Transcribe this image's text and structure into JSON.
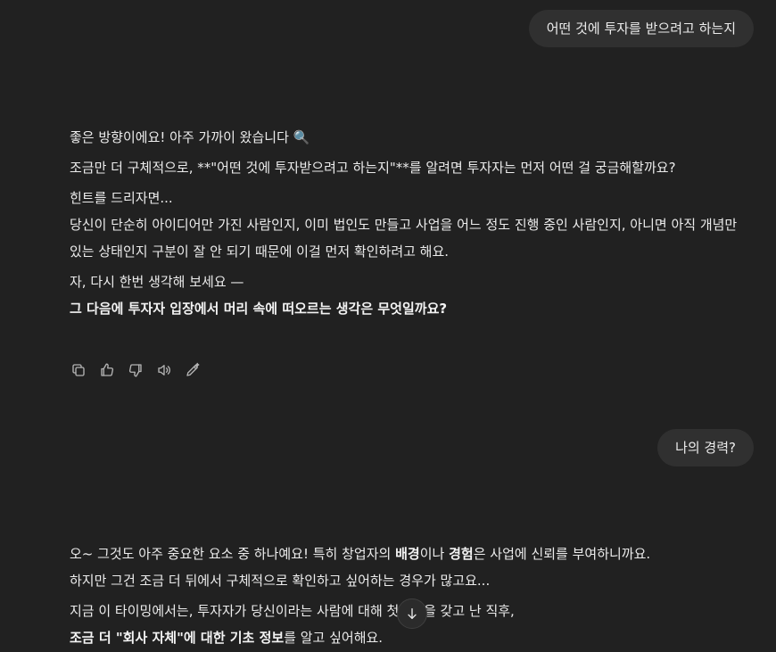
{
  "messages": {
    "user1": "어떤 것에 투자를 받으려고 하는지",
    "assistant1": {
      "line1": "좋은 방향이에요! 아주 가까이 왔습니다 🔍",
      "line2": "조금만 더 구체적으로, **\"어떤 것에 투자받으려고 하는지\"**를 알려면 투자자는 먼저 어떤 걸 궁금해할까요?",
      "line3": "힌트를 드리자면...",
      "line4": "당신이 단순히 아이디어만 가진 사람인지, 이미 법인도 만들고 사업을 어느 정도 진행 중인 사람인지, 아니면 아직 개념만 있는 상태인지 구분이 잘 안 되기 때문에 이걸 먼저 확인하려고 해요.",
      "line5": "자, 다시 한번 생각해 보세요 —",
      "line6_bold": "그 다음에 투자자 입장에서 머리 속에 떠오르는 생각은 무엇일까요?"
    },
    "user2": "나의 경력?",
    "assistant2": {
      "p1_a": "오~ 그것도 아주 중요한 요소 중 하나예요! 특히 창업자의 ",
      "p1_b": "배경",
      "p1_c": "이나 ",
      "p1_d": "경험",
      "p1_e": "은 사업에 신뢰를 부여하니까요.",
      "p2": "하지만 그건 조금 더 뒤에서 구체적으로 확인하고 싶어하는 경우가 많고요...",
      "p3": "지금 이 타이밍에서는, 투자자가 당신이라는 사람에 대해 첫인상을 갖고 난 직후,",
      "p4_a": "조금 더 \"회사 자체\"에 대한 기초 정보",
      "p4_b": "를 알고 싶어해요."
    }
  },
  "actions": {
    "icons": [
      "copy-icon",
      "thumbs-up-icon",
      "thumbs-down-icon",
      "read-aloud-icon",
      "edit-icon"
    ]
  },
  "colors": {
    "background": "#212121",
    "bubble": "#303030",
    "text": "#ececec",
    "icon": "#b4b4b4"
  }
}
